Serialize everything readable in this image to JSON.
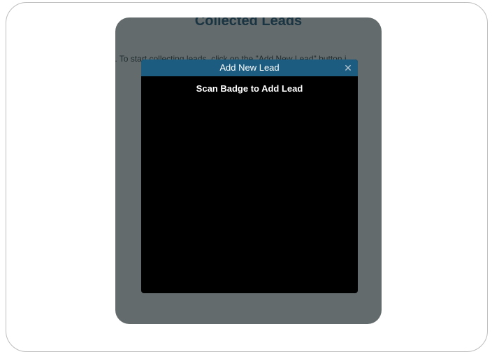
{
  "page": {
    "title": "Collected Leads",
    "empty_message": "nd. To start collecting leads, click on the \"Add New Lead\" button i"
  },
  "modal": {
    "title": "Add New Lead",
    "close_glyph": "✕",
    "body_text": "Scan Badge to Add Lead"
  },
  "colors": {
    "header": "#1b5c80",
    "overlay": "#636b6c",
    "modal_bg": "#000000"
  }
}
